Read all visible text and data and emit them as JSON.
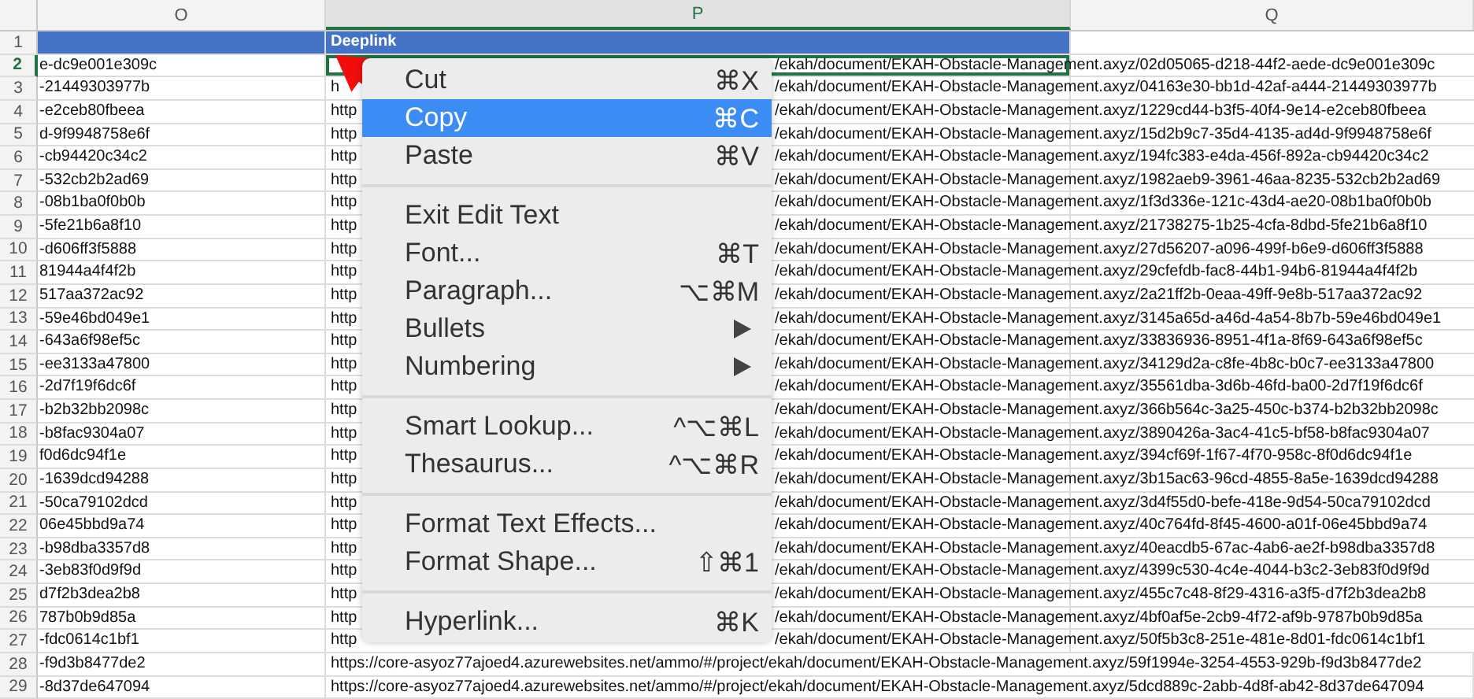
{
  "columns": [
    {
      "label": "O",
      "selected": false
    },
    {
      "label": "P",
      "selected": true
    },
    {
      "label": "Q",
      "selected": false
    }
  ],
  "header_row": {
    "number": "1",
    "deeplink_title": "Deeplink"
  },
  "rows": [
    {
      "number": "2",
      "selected": true,
      "column_o": "e-dc9e001e309c",
      "deeplink_end": "/ekah/document/EKAH-Obstacle-Management.axyz/02d05065-d218-44f2-aede-dc9e001e309c"
    },
    {
      "number": "3",
      "selected": false,
      "column_o": "-21449303977b",
      "deeplink_start": "h",
      "deeplink_end": "/ekah/document/EKAH-Obstacle-Management.axyz/04163e30-bb1d-42af-a444-21449303977b"
    },
    {
      "number": "4",
      "selected": false,
      "column_o": "-e2ceb80fbeea",
      "deeplink_start": "http",
      "deeplink_end": "/ekah/document/EKAH-Obstacle-Management.axyz/1229cd44-b3f5-40f4-9e14-e2ceb80fbeea"
    },
    {
      "number": "5",
      "selected": false,
      "column_o": "d-9f9948758e6f",
      "deeplink_start": "http",
      "deeplink_end": "/ekah/document/EKAH-Obstacle-Management.axyz/15d2b9c7-35d4-4135-ad4d-9f9948758e6f"
    },
    {
      "number": "6",
      "selected": false,
      "column_o": "-cb94420c34c2",
      "deeplink_start": "http",
      "deeplink_end": "/ekah/document/EKAH-Obstacle-Management.axyz/194fc383-e4da-456f-892a-cb94420c34c2"
    },
    {
      "number": "7",
      "selected": false,
      "column_o": "-532cb2b2ad69",
      "deeplink_start": "http",
      "deeplink_end": "/ekah/document/EKAH-Obstacle-Management.axyz/1982aeb9-3961-46aa-8235-532cb2b2ad69"
    },
    {
      "number": "8",
      "selected": false,
      "column_o": "-08b1ba0f0b0b",
      "deeplink_start": "http",
      "deeplink_end": "/ekah/document/EKAH-Obstacle-Management.axyz/1f3d336e-121c-43d4-ae20-08b1ba0f0b0b"
    },
    {
      "number": "9",
      "selected": false,
      "column_o": "-5fe21b6a8f10",
      "deeplink_start": "http",
      "deeplink_end": "/ekah/document/EKAH-Obstacle-Management.axyz/21738275-1b25-4cfa-8dbd-5fe21b6a8f10"
    },
    {
      "number": "10",
      "selected": false,
      "column_o": "-d606ff3f5888",
      "deeplink_start": "http",
      "deeplink_end": "/ekah/document/EKAH-Obstacle-Management.axyz/27d56207-a096-499f-b6e9-d606ff3f5888"
    },
    {
      "number": "11",
      "selected": false,
      "column_o": "81944a4f4f2b",
      "deeplink_start": "http",
      "deeplink_end": "/ekah/document/EKAH-Obstacle-Management.axyz/29cfefdb-fac8-44b1-94b6-81944a4f4f2b"
    },
    {
      "number": "12",
      "selected": false,
      "column_o": "517aa372ac92",
      "deeplink_start": "http",
      "deeplink_end": "/ekah/document/EKAH-Obstacle-Management.axyz/2a21ff2b-0eaa-49ff-9e8b-517aa372ac92"
    },
    {
      "number": "13",
      "selected": false,
      "column_o": "-59e46bd049e1",
      "deeplink_start": "http",
      "deeplink_end": "/ekah/document/EKAH-Obstacle-Management.axyz/3145a65d-a46d-4a54-8b7b-59e46bd049e1"
    },
    {
      "number": "14",
      "selected": false,
      "column_o": "-643a6f98ef5c",
      "deeplink_start": "http",
      "deeplink_end": "/ekah/document/EKAH-Obstacle-Management.axyz/33836936-8951-4f1a-8f69-643a6f98ef5c"
    },
    {
      "number": "15",
      "selected": false,
      "column_o": "-ee3133a47800",
      "deeplink_start": "http",
      "deeplink_end": "/ekah/document/EKAH-Obstacle-Management.axyz/34129d2a-c8fe-4b8c-b0c7-ee3133a47800"
    },
    {
      "number": "16",
      "selected": false,
      "column_o": "-2d7f19f6dc6f",
      "deeplink_start": "http",
      "deeplink_end": "/ekah/document/EKAH-Obstacle-Management.axyz/35561dba-3d6b-46fd-ba00-2d7f19f6dc6f"
    },
    {
      "number": "17",
      "selected": false,
      "column_o": "-b2b32bb2098c",
      "deeplink_start": "http",
      "deeplink_end": "/ekah/document/EKAH-Obstacle-Management.axyz/366b564c-3a25-450c-b374-b2b32bb2098c"
    },
    {
      "number": "18",
      "selected": false,
      "column_o": "-b8fac9304a07",
      "deeplink_start": "http",
      "deeplink_end": "/ekah/document/EKAH-Obstacle-Management.axyz/3890426a-3ac4-41c5-bf58-b8fac9304a07"
    },
    {
      "number": "19",
      "selected": false,
      "column_o": "f0d6dc94f1e",
      "deeplink_start": "http",
      "deeplink_end": "/ekah/document/EKAH-Obstacle-Management.axyz/394cf69f-1f67-4f70-958c-8f0d6dc94f1e"
    },
    {
      "number": "20",
      "selected": false,
      "column_o": "-1639dcd94288",
      "deeplink_start": "http",
      "deeplink_end": "/ekah/document/EKAH-Obstacle-Management.axyz/3b15ac63-96cd-4855-8a5e-1639dcd94288"
    },
    {
      "number": "21",
      "selected": false,
      "column_o": "-50ca79102dcd",
      "deeplink_start": "http",
      "deeplink_end": "/ekah/document/EKAH-Obstacle-Management.axyz/3d4f55d0-befe-418e-9d54-50ca79102dcd"
    },
    {
      "number": "22",
      "selected": false,
      "column_o": "06e45bbd9a74",
      "deeplink_start": "http",
      "deeplink_end": "/ekah/document/EKAH-Obstacle-Management.axyz/40c764fd-8f45-4600-a01f-06e45bbd9a74"
    },
    {
      "number": "23",
      "selected": false,
      "column_o": "-b98dba3357d8",
      "deeplink_start": "http",
      "deeplink_end": "/ekah/document/EKAH-Obstacle-Management.axyz/40eacdb5-67ac-4ab6-ae2f-b98dba3357d8"
    },
    {
      "number": "24",
      "selected": false,
      "column_o": "-3eb83f0d9f9d",
      "deeplink_start": "http",
      "deeplink_end": "/ekah/document/EKAH-Obstacle-Management.axyz/4399c530-4c4e-4044-b3c2-3eb83f0d9f9d"
    },
    {
      "number": "25",
      "selected": false,
      "column_o": "d7f2b3dea2b8",
      "deeplink_start": "http",
      "deeplink_end": "/ekah/document/EKAH-Obstacle-Management.axyz/455c7c48-8f29-4316-a3f5-d7f2b3dea2b8"
    },
    {
      "number": "26",
      "selected": false,
      "column_o": "787b0b9d85a",
      "deeplink_start": "http",
      "deeplink_end": "/ekah/document/EKAH-Obstacle-Management.axyz/4bf0af5e-2cb9-4f72-af9b-9787b0b9d85a"
    },
    {
      "number": "27",
      "selected": false,
      "column_o": "-fdc0614c1bf1",
      "deeplink_start": "http",
      "deeplink_end": "/ekah/document/EKAH-Obstacle-Management.axyz/50f5b3c8-251e-481e-8d01-fdc0614c1bf1"
    },
    {
      "number": "28",
      "selected": false,
      "column_o": "-f9d3b8477de2",
      "deeplink": "https://core-asyoz77ajoed4.azurewebsites.net/ammo/#/project/ekah/document/EKAH-Obstacle-Management.axyz/59f1994e-3254-4553-929b-f9d3b8477de2"
    },
    {
      "number": "29",
      "selected": false,
      "column_o": "-8d37de647094",
      "deeplink": "https://core-asyoz77ajoed4.azurewebsites.net/ammo/#/project/ekah/document/EKAH-Obstacle-Management.axyz/5dcd889c-2abb-4d8f-ab42-8d37de647094"
    }
  ],
  "context_menu": {
    "groups": [
      [
        {
          "label": "Cut",
          "shortcut": "⌘X",
          "selected": false,
          "submenu": false
        },
        {
          "label": "Copy",
          "shortcut": "⌘C",
          "selected": true,
          "submenu": false
        },
        {
          "label": "Paste",
          "shortcut": "⌘V",
          "selected": false,
          "submenu": false
        }
      ],
      [
        {
          "label": "Exit Edit Text",
          "selected": false,
          "submenu": false
        },
        {
          "label": "Font...",
          "shortcut": "⌘T",
          "selected": false,
          "submenu": false
        },
        {
          "label": "Paragraph...",
          "shortcut": "⌥⌘M",
          "selected": false,
          "submenu": false
        },
        {
          "label": "Bullets",
          "selected": false,
          "submenu": true
        },
        {
          "label": "Numbering",
          "selected": false,
          "submenu": true
        }
      ],
      [
        {
          "label": "Smart Lookup...",
          "shortcut": "^⌥⌘L",
          "selected": false,
          "submenu": false
        },
        {
          "label": "Thesaurus...",
          "shortcut": "^⌥⌘R",
          "selected": false,
          "submenu": false
        }
      ],
      [
        {
          "label": "Format Text Effects...",
          "selected": false,
          "submenu": false
        },
        {
          "label": "Format Shape...",
          "shortcut": "⇧⌘1",
          "selected": false,
          "submenu": false
        }
      ],
      [
        {
          "label": "Hyperlink...",
          "shortcut": "⌘K",
          "selected": false,
          "submenu": false
        }
      ]
    ]
  }
}
